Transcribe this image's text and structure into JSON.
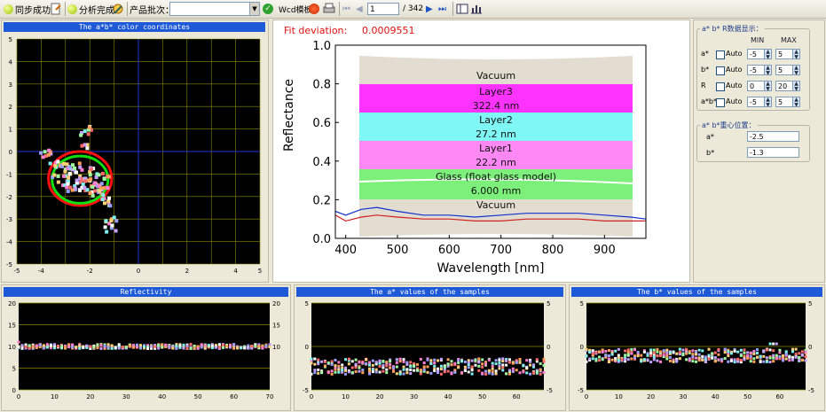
{
  "toolbar": {
    "sync_label": "同步成功",
    "analysis_label": "分析完成",
    "batch_label": "产品批次：",
    "batch_value": "",
    "template_label": "Wcd模板",
    "page_current": "1",
    "page_total": "/ 342"
  },
  "fit": {
    "label": "Fit deviation:",
    "value": "0.0009551",
    "ylabel": "Reflectance",
    "xlabel": "Wavelength [nm]",
    "layers": [
      {
        "name": "Vacuum",
        "thickness": "",
        "color": "#e2ddd0"
      },
      {
        "name": "Layer3",
        "thickness": "322.4 nm",
        "color": "#ff33ff"
      },
      {
        "name": "Layer2",
        "thickness": "27.2 nm",
        "color": "#7ff7f5"
      },
      {
        "name": "Layer1",
        "thickness": "22.2 nm",
        "color": "#ff88f5"
      },
      {
        "name": "Glass (float glass model)",
        "thickness": "6.000 mm",
        "color": "#7cf07a"
      },
      {
        "name": "Vacuum",
        "thickness": "",
        "color": "#e2ddd0"
      }
    ]
  },
  "ab_panel": {
    "title": "The a*b* color coordinates",
    "x_ticks": [
      "-5",
      "-4",
      "-2",
      "0",
      "2",
      "4",
      "5"
    ],
    "y_ticks": [
      "5",
      "4",
      "3",
      "2",
      "1",
      "0",
      "-1",
      "-2",
      "-3",
      "-4",
      "-5"
    ]
  },
  "settings": {
    "display_group": "a* b* R数据显示：",
    "min_header": "MIN",
    "max_header": "MAX",
    "rows": [
      {
        "name": "a*",
        "auto": "Auto",
        "min": "-5",
        "max": "5"
      },
      {
        "name": "b*",
        "auto": "Auto",
        "min": "-5",
        "max": "5"
      },
      {
        "name": "R",
        "auto": "Auto",
        "min": "0",
        "max": "20"
      },
      {
        "name": "a*b*",
        "auto": "Auto",
        "min": "-5",
        "max": "5"
      }
    ],
    "center_group": "a* b*重心位置：",
    "center_a_label": "a*",
    "center_a_value": "-2.5",
    "center_b_label": "b*",
    "center_b_value": "-1.3"
  },
  "bottom_titles": {
    "reflectivity": "Reflectivity",
    "a_values": "The a* values of the samples",
    "b_values": "The b* values of the samples"
  },
  "colors": {
    "accent": "#1e5ad8",
    "plot_bg": "#000000",
    "grid": "#8a8a00"
  },
  "chart_data": [
    {
      "type": "scatter",
      "title": "The a*b* color coordinates",
      "xlim": [
        -5,
        5
      ],
      "ylim": [
        -5,
        5
      ],
      "grid": true,
      "ellipses": [
        {
          "color": "red",
          "center": [
            -2.4,
            -1.2
          ],
          "rx": 1.3,
          "ry": 1.2
        },
        {
          "color": "green",
          "center": [
            -2.4,
            -1.25
          ],
          "rx": 1.15,
          "ry": 1.05
        }
      ],
      "points": [
        [
          -2.8,
          -1.0
        ],
        [
          -2.6,
          -0.9
        ],
        [
          -2.4,
          -1.1
        ],
        [
          -2.2,
          -1.2
        ],
        [
          -2.0,
          -1.3
        ],
        [
          -1.8,
          -1.4
        ],
        [
          -1.6,
          -1.5
        ],
        [
          -3.0,
          -0.8
        ],
        [
          -3.2,
          -0.6
        ],
        [
          -3.4,
          -0.5
        ],
        [
          -2.5,
          -1.4
        ],
        [
          -2.3,
          -1.6
        ],
        [
          -2.1,
          -1.7
        ],
        [
          -1.9,
          -1.8
        ],
        [
          -1.5,
          -1.7
        ],
        [
          -1.3,
          -1.6
        ],
        [
          -1.2,
          -2.4
        ],
        [
          -1.1,
          -3.0
        ],
        [
          -1.2,
          -3.2
        ],
        [
          -1.1,
          -3.4
        ],
        [
          -2.1,
          0.3
        ],
        [
          -2.2,
          0.9
        ],
        [
          -2.0,
          1.1
        ],
        [
          -3.6,
          -0.1
        ],
        [
          -3.8,
          -0.2
        ],
        [
          -2.7,
          -0.6
        ],
        [
          -2.9,
          -1.3
        ],
        [
          -3.1,
          -1.5
        ],
        [
          -2.6,
          -1.7
        ],
        [
          -2.0,
          -0.9
        ],
        [
          -1.7,
          -1.0
        ],
        [
          -1.4,
          -1.2
        ],
        [
          -2.4,
          -0.7
        ],
        [
          -2.8,
          -1.6
        ],
        [
          -3.3,
          -1.1
        ],
        [
          -1.5,
          -1.9
        ],
        [
          -1.4,
          -2.1
        ]
      ]
    },
    {
      "type": "scatter",
      "title": "Reflectivity",
      "xlim": [
        0,
        70
      ],
      "ylim": [
        0,
        20
      ],
      "grid": true,
      "series_value_range": [
        9.5,
        10.5
      ],
      "first_point": 11
    },
    {
      "type": "scatter",
      "title": "The a* values of the samples",
      "xlim": [
        0,
        68
      ],
      "ylim": [
        -5,
        5
      ],
      "grid": true,
      "series_value_range": [
        -3.2,
        -1.4
      ]
    },
    {
      "type": "scatter",
      "title": "The b* values of the samples",
      "xlim": [
        0,
        68
      ],
      "ylim": [
        -5,
        5
      ],
      "grid": true,
      "series_value_range": [
        -1.8,
        -0.3
      ],
      "peak": [
        58,
        0.3
      ]
    },
    {
      "type": "line",
      "title": "",
      "xlabel": "Wavelength [nm]",
      "ylabel": "Reflectance",
      "xlim": [
        380,
        980
      ],
      "ylim": [
        0,
        1.0
      ],
      "x_ticks": [
        400,
        500,
        600,
        700,
        800,
        900
      ],
      "y_ticks": [
        0.0,
        0.2,
        0.4,
        0.6,
        0.8,
        1.0
      ],
      "series": [
        {
          "color": "blue",
          "x": [
            380,
            400,
            430,
            460,
            500,
            550,
            600,
            650,
            700,
            750,
            800,
            850,
            900,
            950,
            980
          ],
          "y": [
            0.14,
            0.12,
            0.15,
            0.16,
            0.14,
            0.12,
            0.12,
            0.11,
            0.12,
            0.13,
            0.13,
            0.13,
            0.12,
            0.11,
            0.1
          ]
        },
        {
          "color": "red",
          "x": [
            380,
            400,
            430,
            460,
            500,
            550,
            600,
            650,
            700,
            750,
            800,
            850,
            900,
            950,
            980
          ],
          "y": [
            0.12,
            0.09,
            0.11,
            0.12,
            0.11,
            0.1,
            0.1,
            0.09,
            0.09,
            0.1,
            0.1,
            0.1,
            0.09,
            0.09,
            0.09
          ]
        }
      ]
    }
  ]
}
